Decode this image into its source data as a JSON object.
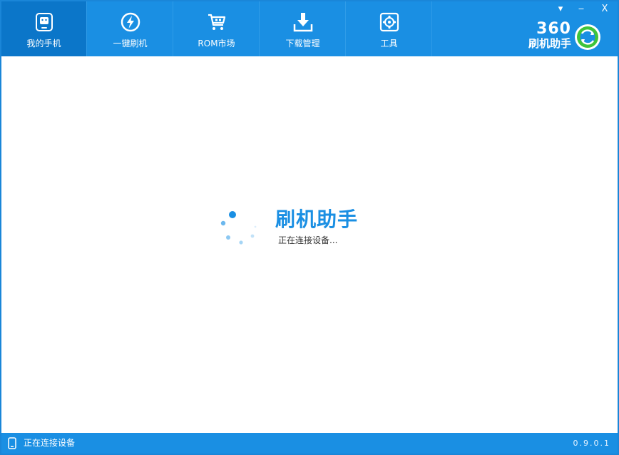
{
  "toolbar": {
    "tabs": [
      {
        "label": "我的手机",
        "icon": "phone-icon",
        "active": true
      },
      {
        "label": "一键刷机",
        "icon": "flash-icon",
        "active": false
      },
      {
        "label": "ROM市场",
        "icon": "cart-icon",
        "active": false
      },
      {
        "label": "下载管理",
        "icon": "download-icon",
        "active": false
      },
      {
        "label": "工具",
        "icon": "toolbox-icon",
        "active": false
      }
    ]
  },
  "window_controls": {
    "menu": "▾",
    "minimize": "‒",
    "close": "X"
  },
  "logo": {
    "number": "360",
    "name": "刷机助手"
  },
  "main": {
    "title": "刷机助手",
    "status": "正在连接设备..."
  },
  "statusbar": {
    "status": "正在连接设备",
    "version": "0.9.0.1"
  },
  "colors": {
    "accent": "#1a8fe3",
    "active_tab": "#0b76c9",
    "logo_green": "#3fc43a"
  }
}
